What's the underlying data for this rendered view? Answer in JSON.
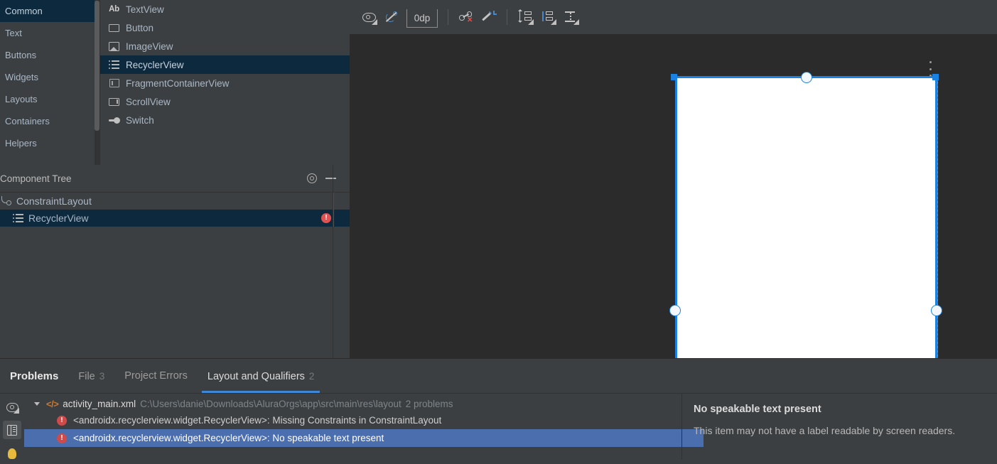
{
  "palette": {
    "categories": [
      {
        "label": "Common",
        "selected": true
      },
      {
        "label": "Text",
        "selected": false
      },
      {
        "label": "Buttons",
        "selected": false
      },
      {
        "label": "Widgets",
        "selected": false
      },
      {
        "label": "Layouts",
        "selected": false
      },
      {
        "label": "Containers",
        "selected": false
      },
      {
        "label": "Helpers",
        "selected": false
      }
    ],
    "items": [
      {
        "label": "TextView",
        "icon": "text-ab-icon",
        "selected": false
      },
      {
        "label": "Button",
        "icon": "button-rect-icon",
        "selected": false
      },
      {
        "label": "ImageView",
        "icon": "image-icon",
        "selected": false
      },
      {
        "label": "RecyclerView",
        "icon": "list-icon",
        "selected": true
      },
      {
        "label": "FragmentContainerView",
        "icon": "fragment-icon",
        "selected": false
      },
      {
        "label": "ScrollView",
        "icon": "scroll-icon",
        "selected": false
      },
      {
        "label": "Switch",
        "icon": "switch-icon",
        "selected": false
      }
    ]
  },
  "component_tree": {
    "title": "Component Tree",
    "rows": [
      {
        "label": "ConstraintLayout",
        "icon": "constraint-layout-icon",
        "selected": false,
        "error": false
      },
      {
        "label": "RecyclerView",
        "icon": "list-icon",
        "selected": true,
        "error": true,
        "error_mark": "!"
      }
    ]
  },
  "design_toolbar": {
    "margin_value": "0dp",
    "buttons": [
      {
        "name": "view-options-icon",
        "tooltip": "View Options"
      },
      {
        "name": "hide-constraints-icon",
        "tooltip": "Show/Hide Constraints"
      },
      {
        "name": "default-margin-field",
        "tooltip": "Default Margin"
      },
      {
        "name": "clear-constraints-icon",
        "tooltip": "Clear All Constraints"
      },
      {
        "name": "infer-constraints-icon",
        "tooltip": "Infer Constraints"
      },
      {
        "name": "pack-icon",
        "tooltip": "Pack"
      },
      {
        "name": "align-icon",
        "tooltip": "Align"
      },
      {
        "name": "guidelines-icon",
        "tooltip": "Guidelines"
      }
    ]
  },
  "canvas": {
    "selected_component": "RecyclerView",
    "overflow_menu": "canvas-overflow-menu"
  },
  "problems": {
    "title": "Problems",
    "tabs": [
      {
        "label": "File",
        "count": "3",
        "active": false
      },
      {
        "label": "Project Errors",
        "count": "",
        "active": false
      },
      {
        "label": "Layout and Qualifiers",
        "count": "2",
        "active": true
      }
    ],
    "file": {
      "name": "activity_main.xml",
      "path": "C:\\Users\\danie\\Downloads\\AluraOrgs\\app\\src\\main\\res\\layout",
      "count_label": "2 problems"
    },
    "items": [
      {
        "text": "<androidx.recyclerview.widget.RecyclerView>: Missing Constraints in ConstraintLayout",
        "severity": "error",
        "mark": "!",
        "selected": false
      },
      {
        "text": "<androidx.recyclerview.widget.RecyclerView>: No speakable text present",
        "severity": "error",
        "mark": "!",
        "selected": true
      }
    ],
    "detail": {
      "title": "No speakable text present",
      "body": "This item may not have a label readable by screen readers."
    },
    "gutter": [
      {
        "name": "preview-eye-icon",
        "active": false
      },
      {
        "name": "side-panel-toggle-icon",
        "active": true
      },
      {
        "name": "lightbulb-icon",
        "active": false
      }
    ]
  },
  "colors": {
    "background": "#3c3f41",
    "canvas": "#2b2b2b",
    "selection_blue": "#0d293e",
    "row_selection": "#4b6eaf",
    "accent_blue": "#1a82e2",
    "tab_underline": "#3f87d6",
    "error_red": "#cf4a4a",
    "xml_orange": "#cc7832"
  }
}
